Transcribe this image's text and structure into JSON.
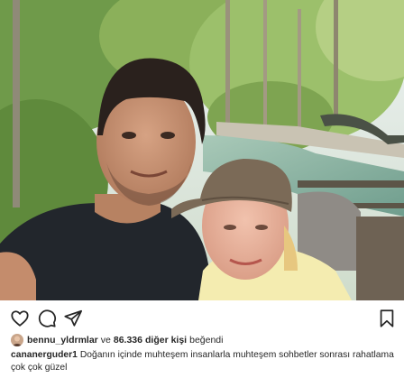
{
  "post": {
    "image_alt": "Selfie of a man and a woman in a cap in front of a forest and stream",
    "liked_by_user": "bennu_yldrmlar",
    "liked_by_joiner": "ve",
    "other_likes_count": "86.336",
    "other_likes_label": "diğer kişi",
    "likes_suffix": "beğendi",
    "caption_user": "cananerguder1",
    "caption_text": "Doğanın içinde muhteşem insanlarla muhteşem sohbetler sonrası rahatlama çok çok güzel"
  },
  "icons": {
    "like": "heart-icon",
    "comment": "comment-bubble-icon",
    "share": "paper-plane-icon",
    "save": "bookmark-icon"
  }
}
